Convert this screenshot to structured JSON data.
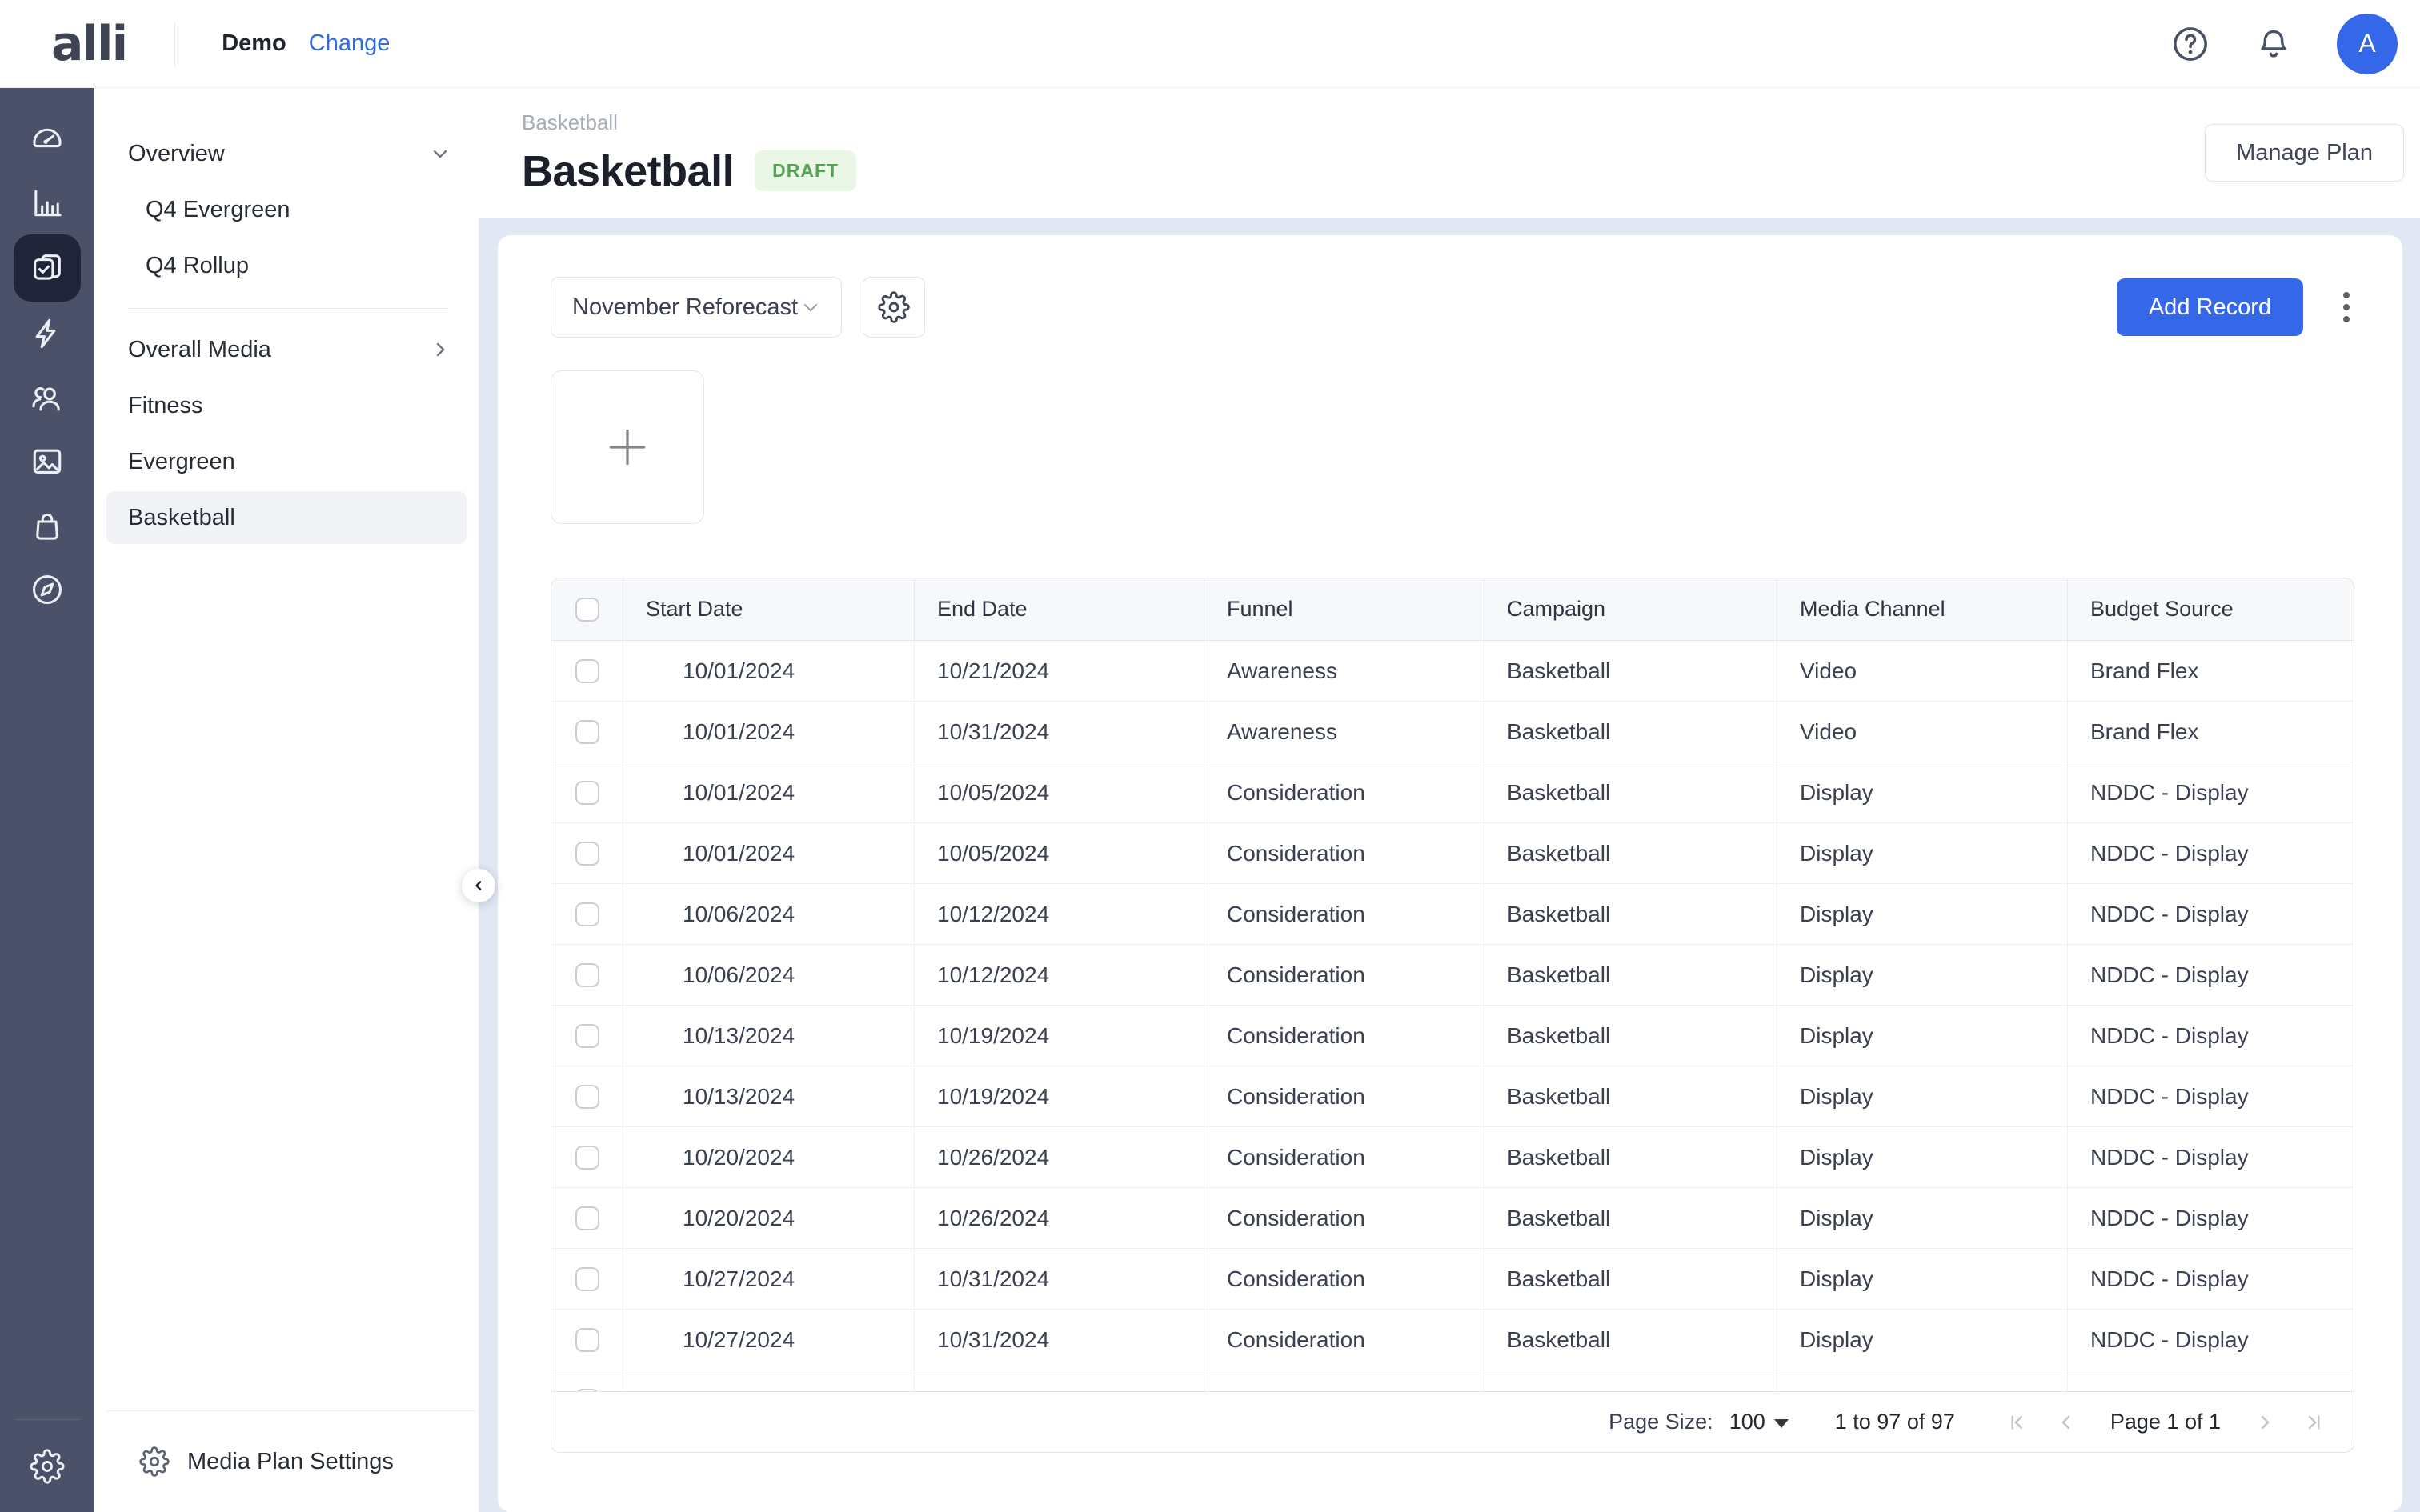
{
  "topbar": {
    "logo": "alli",
    "workspace": "Demo",
    "change_link": "Change",
    "avatar_initial": "A",
    "icons": [
      "help-icon",
      "bell-icon",
      "avatar"
    ]
  },
  "rail": {
    "icons": [
      "gauge-icon",
      "bar-chart-icon",
      "media-plan-icon",
      "lightning-icon",
      "audiences-icon",
      "image-icon",
      "bag-icon",
      "compass-icon",
      "gear-icon"
    ],
    "active_index": 2
  },
  "sidebar": {
    "items": [
      {
        "label": "Overview"
      },
      {
        "label": "Q4 Evergreen"
      },
      {
        "label": "Q4 Rollup"
      },
      {
        "label": "Overall Media"
      },
      {
        "label": "Fitness"
      },
      {
        "label": "Evergreen"
      },
      {
        "label": "Basketball"
      }
    ],
    "settings_label": "Media Plan Settings"
  },
  "page": {
    "breadcrumb": "Basketball",
    "title": "Basketball",
    "status_badge": "DRAFT",
    "manage_button": "Manage Plan"
  },
  "toolbar": {
    "scenario_select": "November Reforecast",
    "add_record_label": "Add Record"
  },
  "table": {
    "columns": [
      "Start Date",
      "End Date",
      "Funnel",
      "Campaign",
      "Media Channel",
      "Budget Source"
    ],
    "rows": [
      {
        "start": "10/01/2024",
        "end": "10/21/2024",
        "funnel": "Awareness",
        "campaign": "Basketball",
        "channel": "Video",
        "budget": "Brand Flex"
      },
      {
        "start": "10/01/2024",
        "end": "10/31/2024",
        "funnel": "Awareness",
        "campaign": "Basketball",
        "channel": "Video",
        "budget": "Brand Flex"
      },
      {
        "start": "10/01/2024",
        "end": "10/05/2024",
        "funnel": "Consideration",
        "campaign": "Basketball",
        "channel": "Display",
        "budget": "NDDC - Display"
      },
      {
        "start": "10/01/2024",
        "end": "10/05/2024",
        "funnel": "Consideration",
        "campaign": "Basketball",
        "channel": "Display",
        "budget": "NDDC - Display"
      },
      {
        "start": "10/06/2024",
        "end": "10/12/2024",
        "funnel": "Consideration",
        "campaign": "Basketball",
        "channel": "Display",
        "budget": "NDDC - Display"
      },
      {
        "start": "10/06/2024",
        "end": "10/12/2024",
        "funnel": "Consideration",
        "campaign": "Basketball",
        "channel": "Display",
        "budget": "NDDC - Display"
      },
      {
        "start": "10/13/2024",
        "end": "10/19/2024",
        "funnel": "Consideration",
        "campaign": "Basketball",
        "channel": "Display",
        "budget": "NDDC - Display"
      },
      {
        "start": "10/13/2024",
        "end": "10/19/2024",
        "funnel": "Consideration",
        "campaign": "Basketball",
        "channel": "Display",
        "budget": "NDDC - Display"
      },
      {
        "start": "10/20/2024",
        "end": "10/26/2024",
        "funnel": "Consideration",
        "campaign": "Basketball",
        "channel": "Display",
        "budget": "NDDC - Display"
      },
      {
        "start": "10/20/2024",
        "end": "10/26/2024",
        "funnel": "Consideration",
        "campaign": "Basketball",
        "channel": "Display",
        "budget": "NDDC - Display"
      },
      {
        "start": "10/27/2024",
        "end": "10/31/2024",
        "funnel": "Consideration",
        "campaign": "Basketball",
        "channel": "Display",
        "budget": "NDDC - Display"
      },
      {
        "start": "10/27/2024",
        "end": "10/31/2024",
        "funnel": "Consideration",
        "campaign": "Basketball",
        "channel": "Display",
        "budget": "NDDC - Display"
      }
    ]
  },
  "pagination": {
    "page_size_label": "Page Size:",
    "page_size": "100",
    "range_text": "1 to 97 of 97",
    "page_text": "Page 1 of 1"
  },
  "colors": {
    "accent_blue": "#3567E9",
    "rail_bg": "#4A5168",
    "rail_active": "#20253A",
    "panel_bg": "#E2E7F4",
    "draft_bg": "#EAF7E6",
    "draft_text": "#55A455"
  }
}
